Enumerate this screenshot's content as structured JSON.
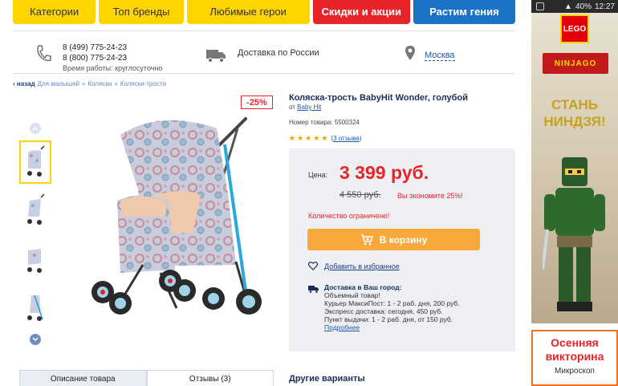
{
  "statusbar": {
    "battery": "40%",
    "time": "12:27"
  },
  "nav": {
    "categories": [
      {
        "label": "Категории",
        "style": "yellow"
      },
      {
        "label": "Топ бренды",
        "style": "yellow"
      },
      {
        "label": "Любимые герои",
        "style": "yellow"
      },
      {
        "label": "Скидки и акции",
        "style": "red"
      },
      {
        "label": "Растим гения",
        "style": "blue"
      }
    ]
  },
  "info": {
    "phone1": "8 (499) 775-24-23",
    "phone2": "8 (800) 775-24-23",
    "hours": "Время работы: круглосуточно",
    "delivery": "Доставка по России",
    "city": "Москва"
  },
  "breadcrumb": {
    "back": "назад",
    "items": [
      "Для малышей",
      "Коляски",
      "Коляски-трости"
    ]
  },
  "product": {
    "discount_badge": "-25%",
    "title": "Коляска-трость BabyHit Wonder, голубой",
    "brand_prefix": "от",
    "brand": "Baby Hit",
    "sku": "Номер товара: 5500324",
    "rating": 5,
    "reviews": "(3 отзыва)",
    "reviews_count_label": "3 отзыва"
  },
  "pricing": {
    "label": "Цена:",
    "price": "3 399 руб.",
    "old_price": "4 550 руб.",
    "savings": "Вы экономите 25%!",
    "limited": "Количество ограничено!",
    "cart_button": "В корзину",
    "favorite": "Добавить в избранное"
  },
  "shipping": {
    "heading": "Доставка в Ваш город:",
    "lines": [
      "Объемный товар!",
      "Курьер МаксиПост: 1 - 2 раб. дня, 200 руб.",
      "Экспресс доставка: сегодня, 450 руб.",
      "Пункт выдачи: 1 - 2 раб. дня, от 150 руб."
    ],
    "more": "Подробнее"
  },
  "tabs": [
    {
      "label": "Описание товара",
      "active": true
    },
    {
      "label": "Отзывы (3)",
      "active": false
    }
  ],
  "variants_title": "Другие варианты",
  "ads": {
    "ad1_brand": "LEGO",
    "ad1_logo": "NINJAGO",
    "ad1_text": "СТАНЬ НИНДЗЯ!",
    "ad2_head": "Осенняя викторина",
    "ad2_sub": "Микроскоп"
  },
  "colors": {
    "accent_yellow": "#ffd500",
    "accent_red": "#e8242b",
    "accent_blue": "#1a73c6",
    "cart_orange": "#f9a93a"
  }
}
